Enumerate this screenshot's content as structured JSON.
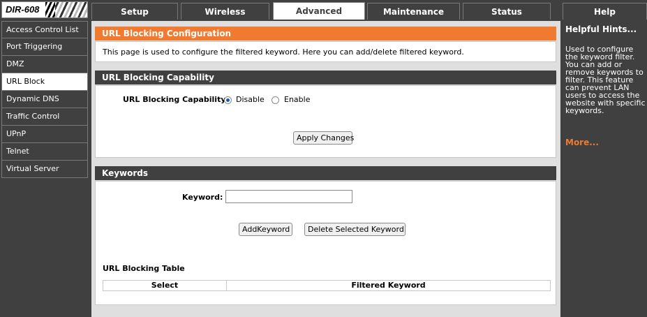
{
  "brand": {
    "model": "DIR-608"
  },
  "tabs": [
    {
      "label": "Setup"
    },
    {
      "label": "Wireless"
    },
    {
      "label": "Advanced"
    },
    {
      "label": "Maintenance"
    },
    {
      "label": "Status"
    },
    {
      "label": "Help"
    }
  ],
  "active_tab": "Advanced",
  "sidebar": {
    "items": [
      {
        "label": "Access Control List"
      },
      {
        "label": "Port Triggering"
      },
      {
        "label": "DMZ"
      },
      {
        "label": "URL Block"
      },
      {
        "label": "Dynamic DNS"
      },
      {
        "label": "Traffic Control"
      },
      {
        "label": "UPnP"
      },
      {
        "label": "Telnet"
      },
      {
        "label": "Virtual Server"
      }
    ],
    "active": "URL Block"
  },
  "config": {
    "title": "URL Blocking Configuration",
    "description": "This page is used to configure the filtered keyword. Here you can add/delete filtered keyword."
  },
  "capability": {
    "title": "URL Blocking Capability",
    "label": "URL Blocking Capability:",
    "option_disable": "Disable",
    "option_enable": "Enable",
    "selected": "Disable",
    "apply_label": "Apply Changes"
  },
  "keywords": {
    "title": "Keywords",
    "keyword_label": "Keyword:",
    "keyword_value": "",
    "add_label": "AddKeyword",
    "delete_label": "Delete Selected Keyword",
    "table_title": "URL Blocking Table",
    "columns": [
      "Select",
      "Filtered Keyword"
    ]
  },
  "help": {
    "title": "Helpful Hints...",
    "text": "Used to configure the keyword filter. You can add or remove keywords to filter. This feature can prevent LAN users to access the website with specific keywords.",
    "more": "More..."
  },
  "colors": {
    "accent_orange": "#f07a2f",
    "dark_gray": "#404040",
    "content_bg": "#dfdfdf"
  }
}
